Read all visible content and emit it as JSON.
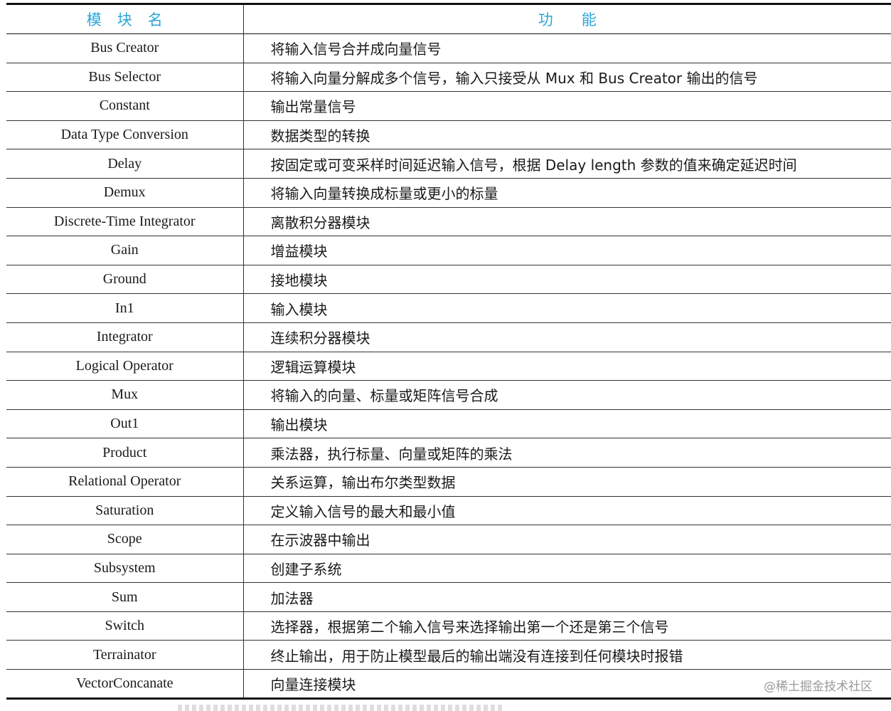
{
  "table": {
    "headers": {
      "name": "模块名",
      "function": "功能"
    },
    "rows": [
      {
        "name": "Bus Creator",
        "function": "将输入信号合并成向量信号"
      },
      {
        "name": "Bus Selector",
        "function": "将输入向量分解成多个信号，输入只接受从 Mux 和 Bus Creator 输出的信号"
      },
      {
        "name": "Constant",
        "function": "输出常量信号"
      },
      {
        "name": "Data Type Conversion",
        "function": "数据类型的转换"
      },
      {
        "name": "Delay",
        "function": "按固定或可变采样时间延迟输入信号，根据 Delay length 参数的值来确定延迟时间"
      },
      {
        "name": "Demux",
        "function": "将输入向量转换成标量或更小的标量"
      },
      {
        "name": "Discrete-Time Integrator",
        "function": "离散积分器模块"
      },
      {
        "name": "Gain",
        "function": "增益模块"
      },
      {
        "name": "Ground",
        "function": "接地模块"
      },
      {
        "name": "In1",
        "function": "输入模块"
      },
      {
        "name": "Integrator",
        "function": "连续积分器模块"
      },
      {
        "name": "Logical Operator",
        "function": "逻辑运算模块"
      },
      {
        "name": "Mux",
        "function": "将输入的向量、标量或矩阵信号合成"
      },
      {
        "name": "Out1",
        "function": "输出模块"
      },
      {
        "name": "Product",
        "function": "乘法器，执行标量、向量或矩阵的乘法"
      },
      {
        "name": "Relational Operator",
        "function": "关系运算，输出布尔类型数据"
      },
      {
        "name": "Saturation",
        "function": "定义输入信号的最大和最小值"
      },
      {
        "name": "Scope",
        "function": "在示波器中输出"
      },
      {
        "name": "Subsystem",
        "function": "创建子系统"
      },
      {
        "name": "Sum",
        "function": "加法器"
      },
      {
        "name": "Switch",
        "function": "选择器，根据第二个输入信号来选择输出第一个还是第三个信号"
      },
      {
        "name": "Terrainator",
        "function": "终止输出，用于防止模型最后的输出端没有连接到任何模块时报错"
      },
      {
        "name": "VectorConcanate",
        "function": "向量连接模块"
      }
    ]
  },
  "watermark": "@稀土掘金技术社区",
  "colors": {
    "header_text": "#2aa6d8",
    "watermark": "#9a9a9a"
  }
}
